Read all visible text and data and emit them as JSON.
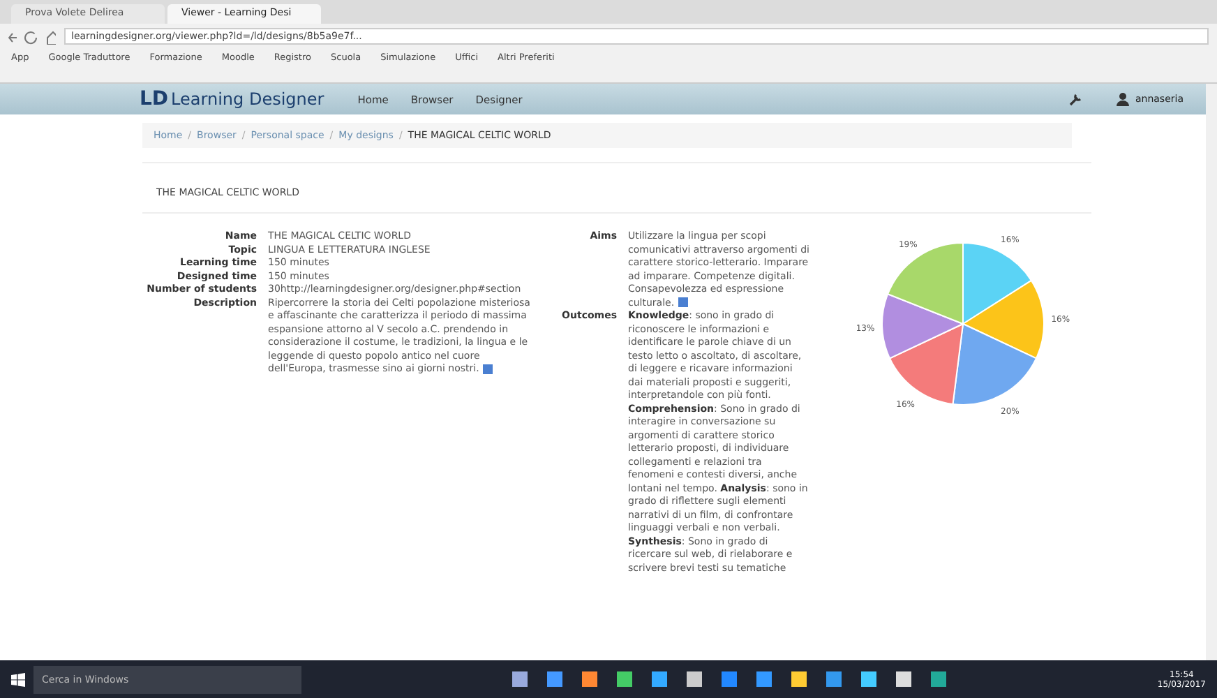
{
  "browser": {
    "tabs": [
      {
        "label": "Prova Volete Delirea",
        "selected": false
      },
      {
        "label": "Viewer - Learning Desi",
        "selected": true
      }
    ],
    "url": "learningdesigner.org/viewer.php?ld=/ld/designs/8b5a9e7f...",
    "bookmarks": [
      "App",
      "Google Traduttore",
      "Formazione",
      "Moodle",
      "Registro",
      "Scuola",
      "Simulazione",
      "Uffici",
      "Altri Preferiti"
    ]
  },
  "site": {
    "logo_mark": "LD",
    "name": "Learning Designer",
    "nav": [
      "Home",
      "Browser",
      "Designer"
    ],
    "user": "annaseria"
  },
  "breadcrumb": [
    "Home",
    "Browser",
    "Personal space",
    "My designs",
    "THE MAGICAL CELTIC WORLD"
  ],
  "breadcrumb_separators": [
    "/",
    "/",
    "/",
    "/"
  ],
  "page_title": "THE MAGICAL CELTIC WORLD",
  "properties": [
    {
      "label": "Name",
      "value": "THE MAGICAL CELTIC WORLD"
    },
    {
      "label": "Topic",
      "value": "LINGUA E LETTERATURA INGLESE"
    },
    {
      "label": "Learning time",
      "value": "150 minutes"
    },
    {
      "label": "Designed time",
      "value": "150 minutes"
    },
    {
      "label": "Number of students",
      "value": "30http://learningdesigner.org/designer.php#section"
    },
    {
      "label": "Description",
      "value": "Ripercorrere la storia dei Celti popolazione misteriosa e affascinante che caratterizza il periodo di massima espansione attorno al V secolo a.C. prendendo in considerazione il costume, le tradizioni, la lingua e le leggende di questo popolo antico nel cuore dell'Europa, trasmesse sino ai giorni nostri."
    }
  ],
  "aims": {
    "label": "Aims",
    "value": "Utilizzare la lingua per scopi comunicativi attraverso argomenti di carattere storico-letterario. Imparare ad imparare. Competenze digitali. Consapevolezza ed espressione culturale."
  },
  "outcomes": {
    "label": "Outcomes",
    "value": "**Knowledge**: sono in grado di riconoscere le informazioni e identificare le parole chiave di un testo letto o ascoltato, di ascoltare, di leggere e ricavare informazioni dai materiali proposti e suggeriti, interpretandole con più fonti. **Comprehension**: Sono in grado di interagire in conversazione su argomenti di carattere storico letterario proposti, di individuare collegamenti e relazioni tra fenomeni e contesti diversi, anche lontani nel tempo. **Analysis**: sono in grado di riflettere sugli elementi narrativi di un film, di confrontare linguaggi verbali e non verbali. **Synthesis**: Sono in grado di ricercare sul web, di rielaborare e scrivere brevi testi su tematiche"
  },
  "chart_data": {
    "type": "pie",
    "values": [
      16,
      16,
      20,
      16,
      13,
      19
    ],
    "colors": [
      "#5bd3f5",
      "#fcc419",
      "#6fa8f0",
      "#f47b7b",
      "#b18ee0",
      "#a8d86a"
    ],
    "value_labels": [
      "16%",
      "16%",
      "20%",
      "16%",
      "13%",
      "19%"
    ]
  },
  "taskbar": {
    "search": "Cerca in Windows",
    "time": "15:54",
    "date": "15/03/2017"
  }
}
